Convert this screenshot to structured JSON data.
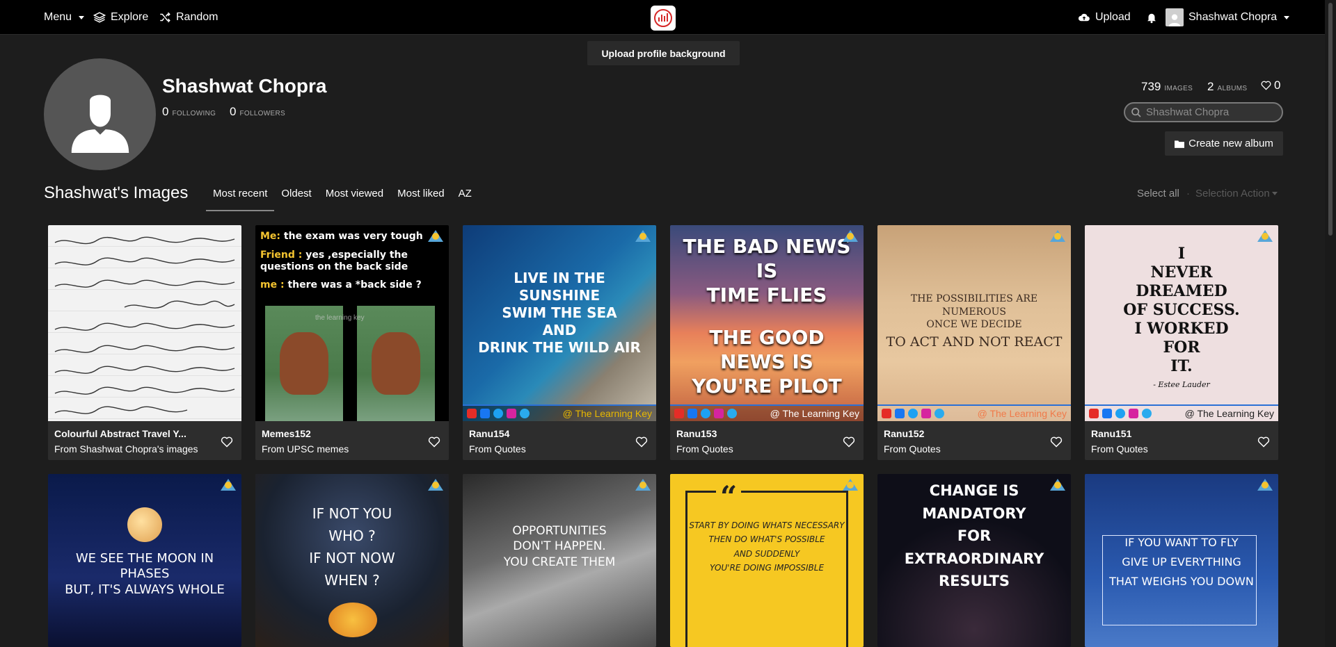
{
  "nav": {
    "menu_label": "Menu",
    "explore_label": "Explore",
    "random_label": "Random",
    "upload_label": "Upload",
    "user_name": "Shashwat Chopra"
  },
  "upload_background_label": "Upload profile background",
  "profile": {
    "name": "Shashwat Chopra",
    "following_count": "0",
    "following_label": "FOLLOWING",
    "followers_count": "0",
    "followers_label": "FOLLOWERS",
    "images_count": "739",
    "images_label": "IMAGES",
    "albums_count": "2",
    "albums_label": "ALBUMS",
    "likes_count": "0"
  },
  "search": {
    "placeholder": "Shashwat Chopra"
  },
  "create_album_label": "Create new album",
  "section": {
    "title": "Shashwat's Images",
    "tabs": [
      "Most recent",
      "Oldest",
      "Most viewed",
      "Most liked",
      "AZ"
    ],
    "select_all_label": "Select all",
    "selection_action_label": "Selection Action"
  },
  "cards": [
    {
      "title": "Colourful Abstract Travel Y...",
      "album": "From Shashwat Chopra's images"
    },
    {
      "title": "Memes152",
      "album": "From UPSC memes"
    },
    {
      "title": "Ranu154",
      "album": "From Quotes"
    },
    {
      "title": "Ranu153",
      "album": "From Quotes"
    },
    {
      "title": "Ranu152",
      "album": "From Quotes"
    },
    {
      "title": "Ranu151",
      "album": "From Quotes"
    }
  ],
  "thumb_text": {
    "meme": {
      "line1_speaker": "Me:",
      "line1": "the exam was very tough",
      "line2_speaker": "Friend :",
      "line2": "yes ,especially the questions on the back side",
      "line3_speaker": "me :",
      "line3": "there was a *back side ?",
      "watermark": "the learning key"
    },
    "ranu154": {
      "quote": "LIVE IN THE SUNSHINE\nSWIM THE SEA\nAND\nDRINK THE WILD AIR",
      "handle": "@ The Learning Key"
    },
    "ranu153": {
      "quote_top": "THE BAD NEWS IS\nTIME FLIES",
      "quote_bottom": "THE GOOD NEWS IS\nYOU'RE PILOT",
      "handle": "@ The Learning Key"
    },
    "ranu152": {
      "quote_small": "THE POSSIBILITIES ARE NUMEROUS\nONCE WE DECIDE",
      "quote_big": "TO ACT AND NOT REACT",
      "handle": "@ The Learning Key"
    },
    "ranu151": {
      "quote": "I\nNEVER\nDREAMED\nOF SUCCESS.\nI WORKED\nFOR\nIT.",
      "author": "- Estee Lauder",
      "handle": "@ The Learning Key"
    },
    "row2": [
      {
        "quote": "WE SEE THE MOON IN PHASES\nBUT, IT'S ALWAYS WHOLE"
      },
      {
        "quote": "IF NOT YOU\nWHO ?\nIF NOT NOW\nWHEN ?"
      },
      {
        "quote": "OPPORTUNITIES\nDON'T HAPPEN.\nYOU CREATE THEM"
      },
      {
        "quote": "START BY DOING WHATS NECESSARY\nTHEN DO WHAT'S POSSIBLE\nAND SUDDENLY\nYOU'RE DOING IMPOSSIBLE"
      },
      {
        "quote": "CHANGE IS MANDATORY\nFOR EXTRAORDINARY\nRESULTS"
      },
      {
        "quote": "IF YOU WANT TO FLY\nGIVE UP EVERYTHING\nTHAT WEIGHS YOU DOWN"
      }
    ]
  },
  "colors": {
    "accent_blue": "#2a70d6",
    "logo_red": "#d62828",
    "meme_yellow": "#f4c430"
  }
}
